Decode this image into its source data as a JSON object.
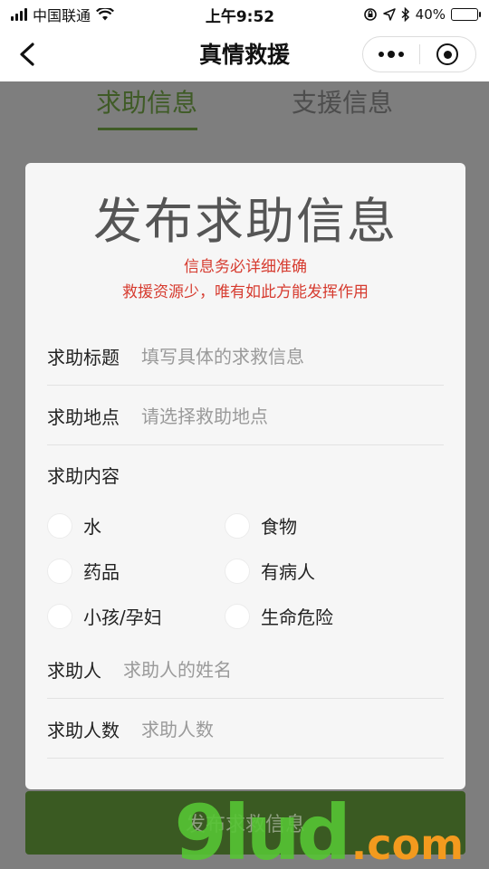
{
  "status_bar": {
    "carrier": "中国联通",
    "time": "上午9:52",
    "battery_percent": "40%",
    "battery_level": 0.4,
    "battery_color": "#f1c232",
    "icons": [
      "signal-icon",
      "wifi-icon",
      "rotation-lock-icon",
      "location-arrow-icon",
      "bluetooth-icon",
      "battery-icon"
    ]
  },
  "nav": {
    "title": "真情救援",
    "back_icon": "back-arrow-icon",
    "more_icon": "more-dots-icon",
    "close_icon": "target-close-icon"
  },
  "tabs": [
    {
      "label": "求助信息",
      "active": true
    },
    {
      "label": "支援信息",
      "active": false
    }
  ],
  "form": {
    "heading": "发布求助信息",
    "warning_line1": "信息务必详细准确",
    "warning_line2": "救援资源少，唯有如此方能发挥作用",
    "title_field": {
      "label": "求助标题",
      "placeholder": "填写具体的求救信息",
      "value": ""
    },
    "location_field": {
      "label": "求助地点",
      "placeholder": "请选择救助地点",
      "value": ""
    },
    "content_label": "求助内容",
    "content_options": [
      {
        "label": "水",
        "checked": false
      },
      {
        "label": "食物",
        "checked": false
      },
      {
        "label": "药品",
        "checked": false
      },
      {
        "label": "有病人",
        "checked": false
      },
      {
        "label": "小孩/孕妇",
        "checked": false
      },
      {
        "label": "生命危险",
        "checked": false
      }
    ],
    "person_field": {
      "label": "求助人",
      "placeholder": "求助人的姓名",
      "value": ""
    },
    "count_field": {
      "label": "求助人数",
      "placeholder": "求助人数",
      "value": ""
    }
  },
  "submit": {
    "label": "发布求救信息"
  },
  "watermark": {
    "main": "9lud",
    "suffix": ".com"
  },
  "colors": {
    "accent_green": "#3f5b26",
    "warning_red": "#d63b2f",
    "overlay_gray": "#7e7e7e",
    "button_green": "#3a5a22"
  }
}
